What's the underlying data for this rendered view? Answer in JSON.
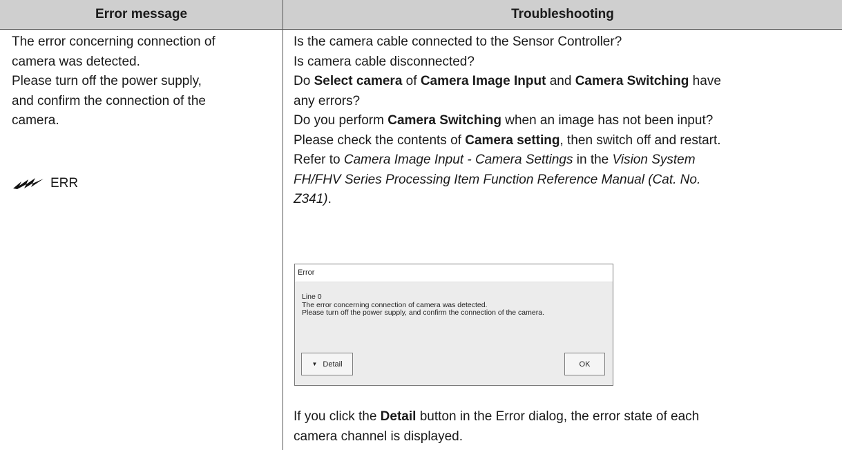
{
  "table": {
    "headers": {
      "error_message": "Error message",
      "troubleshooting": "Troubleshooting"
    }
  },
  "left": {
    "message_lines": [
      "The error concerning connection of",
      "camera was detected.",
      "Please turn off the power supply,",
      "and confirm the connection of the",
      "camera."
    ],
    "indicator_label": "ERR",
    "indicator_icon": "flashing-indicator-icon"
  },
  "right": {
    "line1": "Is the camera cable connected to the Sensor Controller?",
    "line2": "Is camera cable disconnected?",
    "line3_pre": "Do ",
    "line3_b1": "Select camera",
    "line3_mid1": " of ",
    "line3_b2": "Camera Image Input",
    "line3_mid2": " and ",
    "line3_b3": "Camera Switching",
    "line3_post": " have",
    "line4": "any errors?",
    "line5_pre": "Do you perform ",
    "line5_b": "Camera Switching",
    "line5_post": " when an image has not been input?",
    "line6_pre": "Please check the contents of ",
    "line6_b": "Camera setting",
    "line6_post": ", then switch off and restart.",
    "line7_pre": "Refer to ",
    "line7_i1": "Camera Image Input - Camera Settings",
    "line7_mid": " in the ",
    "line7_i2": "Vision System",
    "line8_i": "FH/FHV Series Processing Item Function Reference Manual (Cat. No.",
    "line9_i": "Z341)",
    "line9_post": "."
  },
  "dialog": {
    "title": "Error",
    "lines": [
      "Line 0",
      "The error concerning connection of camera was detected.",
      "Please turn off the power supply, and confirm the connection of the camera."
    ],
    "detail_button": "Detail",
    "ok_button": "OK"
  },
  "bottom": {
    "line1_pre": "If you click the ",
    "line1_b": "Detail",
    "line1_post": " button in the Error dialog, the error state of each",
    "line2": "camera channel is displayed."
  }
}
